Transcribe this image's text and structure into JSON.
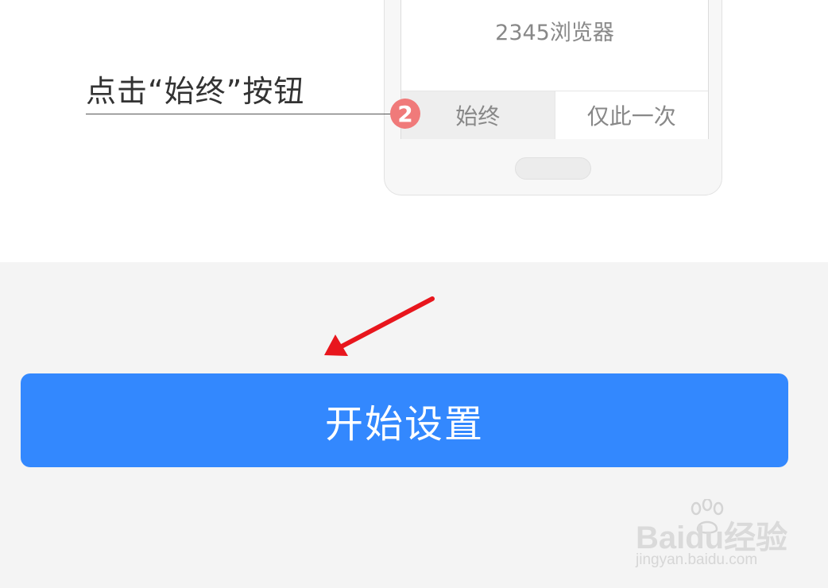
{
  "instruction": {
    "text": "点击“始终”按钮",
    "step_number": "2"
  },
  "dialog": {
    "app_name": "2345浏览器",
    "always_label": "始终",
    "once_label": "仅此一次"
  },
  "main": {
    "start_button_label": "开始设置"
  },
  "watermark": {
    "logo_text": "Baidu经验",
    "url": "jingyan.baidu.com"
  },
  "colors": {
    "button_blue": "#3388fe",
    "annotation_red": "#e8161d",
    "badge_red": "#f07a7a",
    "background_grey": "#f4f4f4"
  }
}
